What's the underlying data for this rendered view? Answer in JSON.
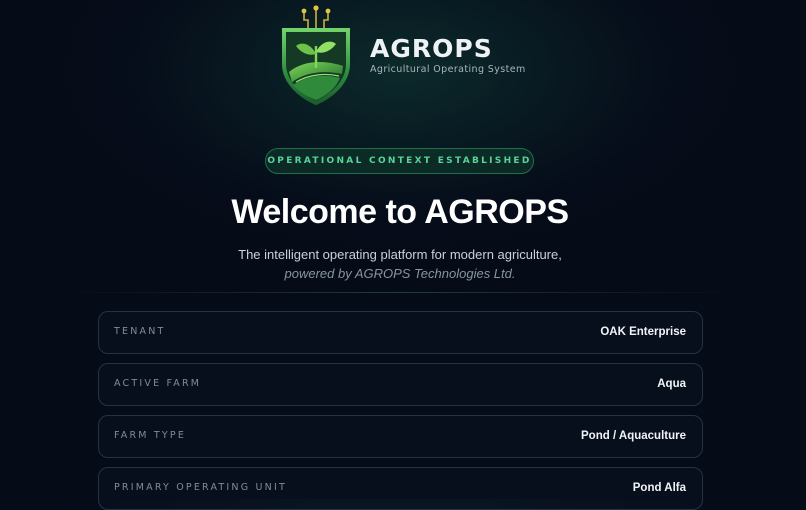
{
  "brand": {
    "name": "AGROPS",
    "subtitle": "Agricultural Operating System",
    "logo_icon": "shield-sprout-circuit-icon",
    "colors": {
      "accent_green": "#58d39a",
      "logo_green": "#4caf50"
    }
  },
  "status_badge": "OPERATIONAL CONTEXT ESTABLISHED",
  "welcome": {
    "title": "Welcome to AGROPS",
    "tagline": "The intelligent operating platform for modern agriculture,",
    "powered_by": "powered by AGROPS Technologies Ltd."
  },
  "context": [
    {
      "label": "TENANT",
      "value": "OAK Enterprise"
    },
    {
      "label": "ACTIVE FARM",
      "value": "Aqua"
    },
    {
      "label": "FARM TYPE",
      "value": "Pond / Aquaculture"
    },
    {
      "label": "PRIMARY OPERATING UNIT",
      "value": "Pond Alfa"
    }
  ]
}
